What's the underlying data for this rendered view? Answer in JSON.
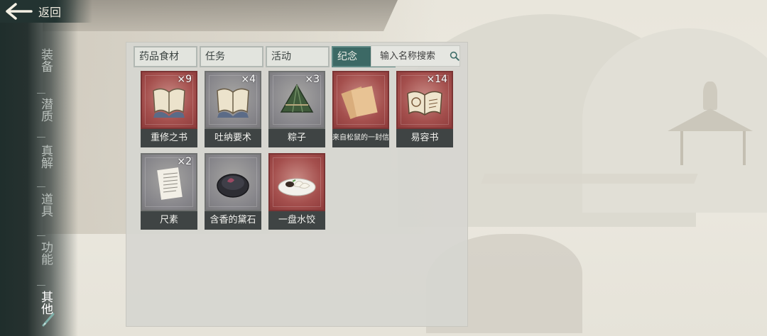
{
  "header": {
    "back_label": "返回"
  },
  "sidebar": {
    "items": [
      {
        "label": "装备",
        "active": false
      },
      {
        "label": "潜质",
        "active": false
      },
      {
        "label": "真解",
        "active": false
      },
      {
        "label": "道具",
        "active": false
      },
      {
        "label": "功能",
        "active": false
      },
      {
        "label": "其他",
        "active": true
      }
    ]
  },
  "tabs": [
    {
      "label": "药品食材",
      "active": false
    },
    {
      "label": "任务",
      "active": false
    },
    {
      "label": "活动",
      "active": false
    },
    {
      "label": "纪念",
      "active": true
    }
  ],
  "search": {
    "placeholder": "输入名称搜索"
  },
  "inventory": [
    {
      "name": "重修之书",
      "count": "×9",
      "bg": "red",
      "icon": "open-book-icon"
    },
    {
      "name": "吐纳要术",
      "count": "×4",
      "bg": "gray",
      "icon": "open-book-icon"
    },
    {
      "name": "粽子",
      "count": "×3",
      "bg": "gray",
      "icon": "zongzi-icon"
    },
    {
      "name": "来自松鼠的一封信",
      "count": "",
      "bg": "red",
      "icon": "letter-icon"
    },
    {
      "name": "易容书",
      "count": "×14",
      "bg": "red",
      "icon": "book-icon"
    },
    {
      "name": "尺素",
      "count": "×2",
      "bg": "gray",
      "icon": "paper-icon"
    },
    {
      "name": "含香的黛石",
      "count": "",
      "bg": "gray",
      "icon": "ink-stone-icon"
    },
    {
      "name": "一盘水饺",
      "count": "",
      "bg": "red",
      "icon": "dumplings-icon"
    }
  ],
  "colors": {
    "active_tab": "#3c6965",
    "sidebar_bg": "#1f2e2c",
    "rare_item_bg": "#a44f4d"
  }
}
